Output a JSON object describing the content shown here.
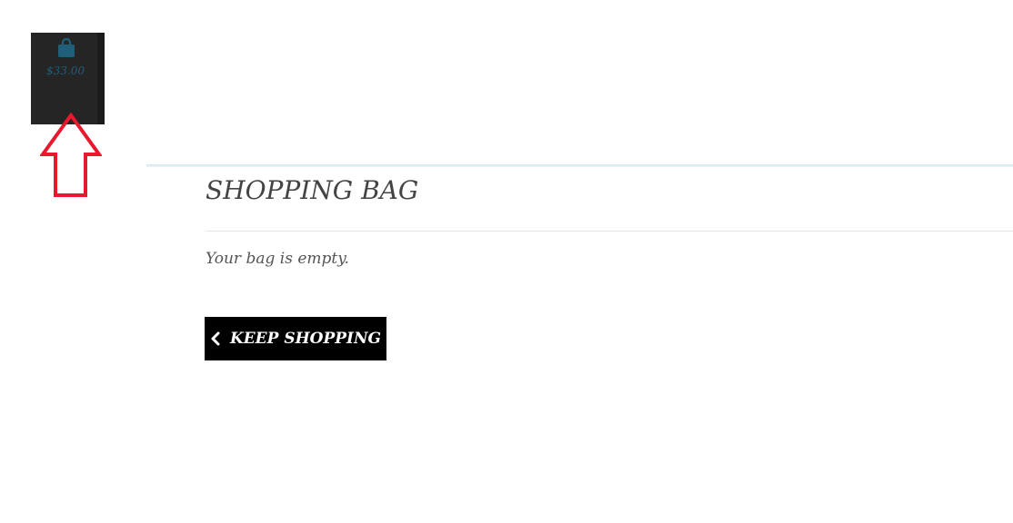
{
  "cart": {
    "icon": "shopping-bag-icon",
    "total": "$33.00",
    "icon_color": "#1f5f7a",
    "background": "#252525"
  },
  "annotation": {
    "icon": "up-arrow-outline-icon",
    "color": "#e8192c"
  },
  "main": {
    "title": "SHOPPING BAG",
    "empty_message": "Your bag is empty.",
    "keep_shopping_label": "KEEP SHOPPING",
    "keep_shopping_icon": "chevron-left-icon"
  }
}
